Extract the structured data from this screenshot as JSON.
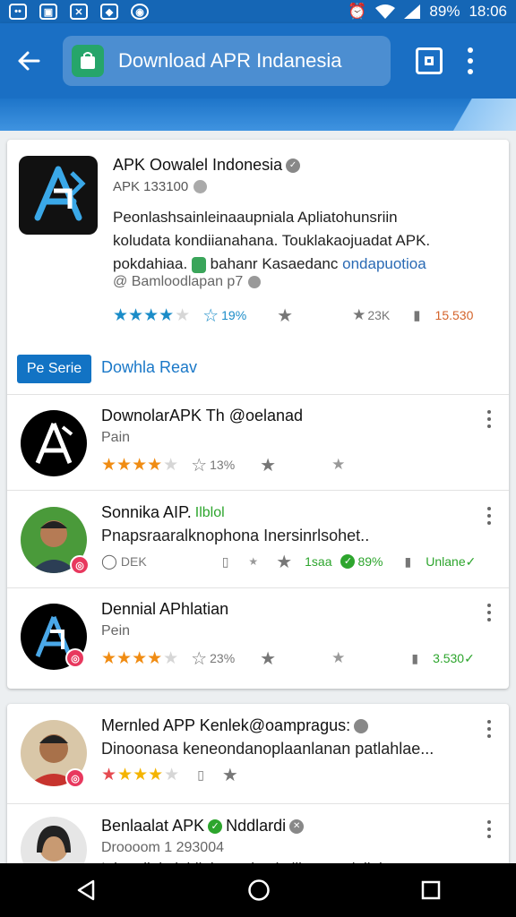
{
  "status_bar": {
    "battery": "89%",
    "time": "18:06",
    "notifications": [
      "chat-icon",
      "image-icon",
      "close-box-icon",
      "app-icon",
      "shield-icon"
    ]
  },
  "app_bar": {
    "search_text": "Download APR Indanesia"
  },
  "featured": {
    "title": "APK Oowalel Indonesia",
    "subtitle": "APK 133100",
    "desc_line1": "Peonlashsainleinaaupniala Apliatohunsriin",
    "desc_line2": "koludata kondiianahana. Touklakaojuadat APK.",
    "desc_line3a": "pokdahiaa.",
    "desc_line3b": "bahanr Kasaedanc",
    "desc_line3c": "ondapuotioa",
    "developer": "@ Bamloodlapan p7",
    "rating_pct": "19%",
    "downloads": "23K",
    "size": "15.530",
    "get_label": "Pe Serie",
    "link_label": "Dowhla Reav",
    "stars": 4
  },
  "list1": [
    {
      "title": "DownolarAPK Th @oelanad",
      "sub": "Pain",
      "stars": 4,
      "pct": "13%",
      "star_color": "orange"
    },
    {
      "title": "Sonnika AIP.",
      "title_tag": "Ilblol",
      "sub": "Pnapsraaralknophona Inersinrlsohet..",
      "search_label": "DEK",
      "label1": "1saa",
      "label2": "89%",
      "label3": "Unlane"
    },
    {
      "title": "Dennial APhlatian",
      "sub": "Pein",
      "stars": 4,
      "pct": "23%",
      "count": "3.530",
      "star_color": "orange"
    }
  ],
  "list2": [
    {
      "title": "Mernled APP Kenlek@oampragus:",
      "sub": "Dinoonasa keneondanoplaanlanan patlahlae...",
      "stars": 4
    },
    {
      "title": "Benlaalat APK",
      "tag": "Nddlardi",
      "sub": "Droooom 1 293004",
      "sub2": "Ialutrailakulabiiakunsgimula lilosuatu lailul"
    }
  ],
  "colors": {
    "app_bar": "#1a6fc4",
    "status_bar": "#1566b5",
    "accent_blue": "#1273c4",
    "star_blue": "#1a8cc8",
    "star_orange": "#f08c13"
  }
}
